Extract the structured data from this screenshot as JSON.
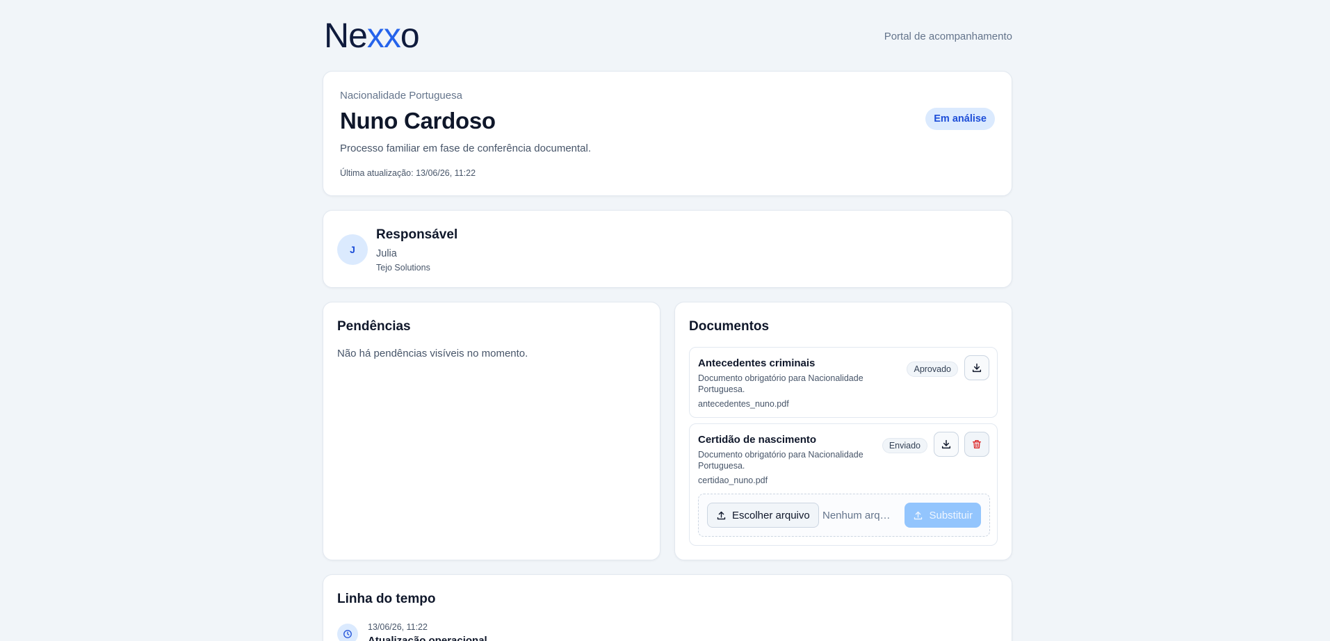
{
  "header": {
    "logo": {
      "part1": "Ne",
      "part2": "xx",
      "part3": "o"
    },
    "portal_link": "Portal de acompanhamento"
  },
  "process": {
    "eyebrow": "Nacionalidade Portuguesa",
    "name": "Nuno Cardoso",
    "description": "Processo familiar em fase de conferência documental.",
    "last_update": "Última atualização: 13/06/26, 11:22",
    "status": "Em análise"
  },
  "responsible": {
    "title": "Responsável",
    "avatar_initial": "J",
    "person": "Julia",
    "company": "Tejo Solutions"
  },
  "pending": {
    "title": "Pendências",
    "empty_text": "Não há pendências visíveis no momento."
  },
  "documents": {
    "title": "Documentos",
    "items": [
      {
        "title": "Antecedentes criminais",
        "requirement": "Documento obrigatório para Nacionalidade Portuguesa.",
        "file": "antecedentes_nuno.pdf",
        "status": "Aprovado"
      },
      {
        "title": "Certidão de nascimento",
        "requirement": "Documento obrigatório para Nacionalidade Portuguesa.",
        "file": "certidao_nuno.pdf",
        "status": "Enviado",
        "upload": {
          "choose_label": "Escolher arquivo",
          "no_file": "Nenhum arquivo escolhido",
          "replace_label": "Substituir"
        }
      }
    ]
  },
  "timeline": {
    "title": "Linha do tempo",
    "items": [
      {
        "date": "13/06/26, 11:22",
        "title": "Atualização operacional"
      }
    ]
  },
  "colors": {
    "accent": "#2563eb",
    "background": "#f1f5f9",
    "status_bg": "#dbeafe",
    "danger": "#dc2626"
  }
}
